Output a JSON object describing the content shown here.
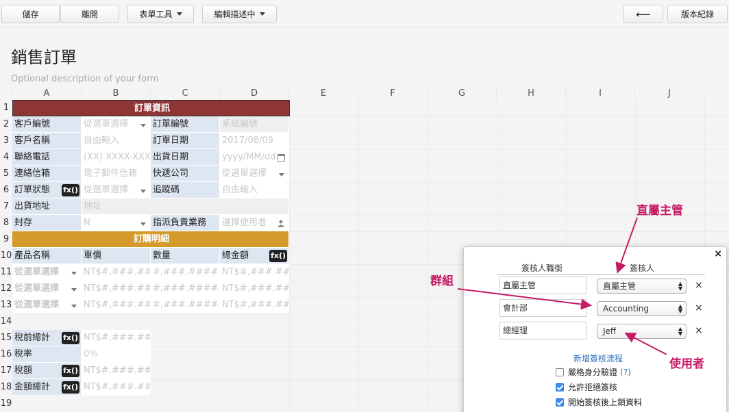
{
  "toolbar": {
    "save": "儲存",
    "leave": "離開",
    "form_tools": "表單工具",
    "editing": "編輯描述中",
    "back_arrow": "⟵",
    "version": "版本紀錄"
  },
  "form": {
    "title": "銷售訂單",
    "description": "Optional description of your form"
  },
  "columns": [
    "A",
    "B",
    "C",
    "D",
    "E",
    "F",
    "G",
    "H",
    "I",
    "J"
  ],
  "rows": [
    "1",
    "2",
    "3",
    "4",
    "5",
    "6",
    "7",
    "8",
    "9",
    "10",
    "11",
    "12",
    "13",
    "14",
    "15",
    "16",
    "17",
    "18",
    "19"
  ],
  "cells": {
    "r1": "訂單資訊",
    "r2": {
      "a": "客戶編號",
      "b": "從選單選擇",
      "c": "訂單編號",
      "d": "系統編號"
    },
    "r3": {
      "a": "客戶名稱",
      "b": "自由輸入",
      "c": "訂單日期",
      "d": "2017/08/09"
    },
    "r4": {
      "a": "聯絡電話",
      "b": "(XX) XXXX-XXXX",
      "c": "出貨日期",
      "d": "yyyy/MM/dd"
    },
    "r5": {
      "a": "連絡信箱",
      "b": "電子郵件信箱",
      "c": "快遞公司",
      "d": "從選單選擇"
    },
    "r6": {
      "a": "訂單狀態",
      "fx": "fx()",
      "b": "從選單選擇",
      "c": "追蹤碼",
      "d": "自由輸入"
    },
    "r7": {
      "a": "出貨地址",
      "b": "地址"
    },
    "r8": {
      "a": "封存",
      "b": "N",
      "c": "指派負責業務",
      "d": "選擇使用者"
    },
    "r9": "訂購明細",
    "r10": {
      "a": "產品名稱",
      "b": "單價",
      "c": "數量",
      "d": "總金額",
      "fx": "fx()"
    },
    "r11": {
      "a": "從選單選擇",
      "b": "NT$#,###.####",
      "c": "#,###.#####",
      "d": "NT$#,###.#####"
    },
    "r12": {
      "a": "從選單選擇",
      "b": "NT$#,###.####",
      "c": "#,###.#####",
      "d": "NT$#,###.#####"
    },
    "r13": {
      "a": "從選單選擇",
      "b": "NT$#,###.####",
      "c": "#,###.#####",
      "d": "NT$#,###.#####"
    },
    "r15": {
      "a": "稅前總計",
      "fx": "fx()",
      "b": "NT$#,###.#####"
    },
    "r16": {
      "a": "稅率",
      "b": "0%"
    },
    "r17": {
      "a": "稅額",
      "fx": "fx()",
      "b": "NT$#,###.#####"
    },
    "r18": {
      "a": "金額總計",
      "fx": "fx()",
      "b": "NT$#,###.#####"
    }
  },
  "approval_panel": {
    "close": "×",
    "col_role": "簽核人職銜",
    "col_approver": "簽核人",
    "rows": [
      {
        "role": "直屬主管",
        "approver": "直屬主管"
      },
      {
        "role": "會計部",
        "approver": "Accounting"
      },
      {
        "role": "總經理",
        "approver": "Jeff"
      }
    ],
    "remove": "×",
    "add_flow": "新增簽核流程",
    "options": [
      {
        "label": "嚴格身分驗證",
        "checked": false,
        "help": "(?)"
      },
      {
        "label": "允許拒絕簽核",
        "checked": true
      },
      {
        "label": "開始簽核後上鎖資料",
        "checked": true
      }
    ]
  },
  "annotations": {
    "manager": "直屬主管",
    "group": "群組",
    "user": "使用者"
  },
  "colors": {
    "section_red": "#8f3535",
    "section_gold": "#d49a2a",
    "label_blue": "#dde6f1",
    "annotation": "#c51a64"
  }
}
